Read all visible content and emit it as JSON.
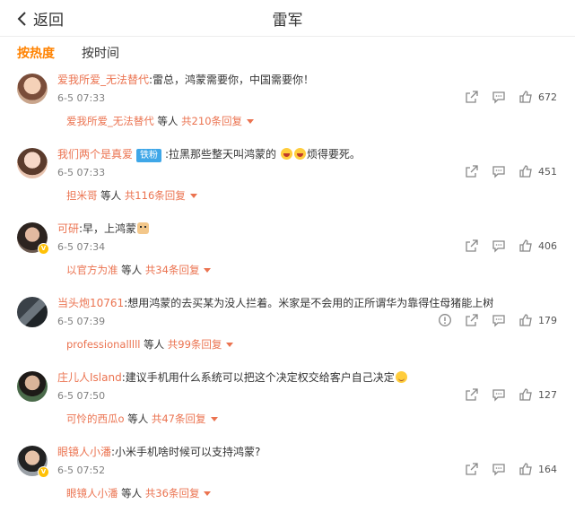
{
  "header": {
    "back_label": "返回",
    "title": "雷军"
  },
  "tabs": [
    {
      "label": "按热度",
      "active": true
    },
    {
      "label": "按时间",
      "active": false
    }
  ],
  "comments": [
    {
      "user": "爱我所爱_无法替代",
      "tag": "",
      "text": ":雷总，鸿蒙需要你，中国需要你！",
      "emoji": "",
      "verified": false,
      "time": "6-5 07:33",
      "likes": "672",
      "reply_user": "爱我所爱_无法替代",
      "reply_mid": " 等人 ",
      "reply_count": "共210条回复",
      "flag": false
    },
    {
      "user": "我们两个是真爱",
      "tag": "铁粉",
      "text": ":拉黑那些整天叫鸿蒙的",
      "emoji": "laugh",
      "text_after": "烦得要死。",
      "verified": false,
      "time": "6-5 07:33",
      "likes": "451",
      "reply_user": "担米哥",
      "reply_mid": " 等人 ",
      "reply_count": "共116条回复",
      "flag": false
    },
    {
      "user": "可研",
      "tag": "",
      "text": ":早，上鸿蒙",
      "emoji": "cat",
      "verified": true,
      "time": "6-5 07:34",
      "likes": "406",
      "reply_user": "以官方为准",
      "reply_mid": " 等人 ",
      "reply_count": "共34条回复",
      "flag": false
    },
    {
      "user": "当头炮10761",
      "tag": "",
      "text": ":想用鸿蒙的去买某为没人拦着。米家是不会用的正所谓华为靠得住母猪能上树",
      "emoji": "",
      "verified": false,
      "time": "6-5 07:39",
      "likes": "179",
      "reply_user": "professionalllll",
      "reply_mid": " 等人 ",
      "reply_count": "共99条回复",
      "flag": true
    },
    {
      "user": "庄儿人Island",
      "tag": "",
      "text": ":建议手机用什么系统可以把这个决定权交给客户自己决定",
      "emoji": "smile",
      "verified": false,
      "time": "6-5 07:50",
      "likes": "127",
      "reply_user": "可怜的西瓜o",
      "reply_mid": " 等人 ",
      "reply_count": "共47条回复",
      "flag": false
    },
    {
      "user": "眼镜人小潘",
      "tag": "",
      "text": ":小米手机啥时候可以支持鸿蒙?",
      "emoji": "",
      "verified": true,
      "time": "6-5 07:52",
      "likes": "164",
      "reply_user": "眼镜人小潘",
      "reply_mid": " 等人 ",
      "reply_count": "共36条回复",
      "flag": false
    }
  ],
  "colors": {
    "accent": "#ff8200",
    "name": "#eb7350",
    "meta": "#808080"
  }
}
